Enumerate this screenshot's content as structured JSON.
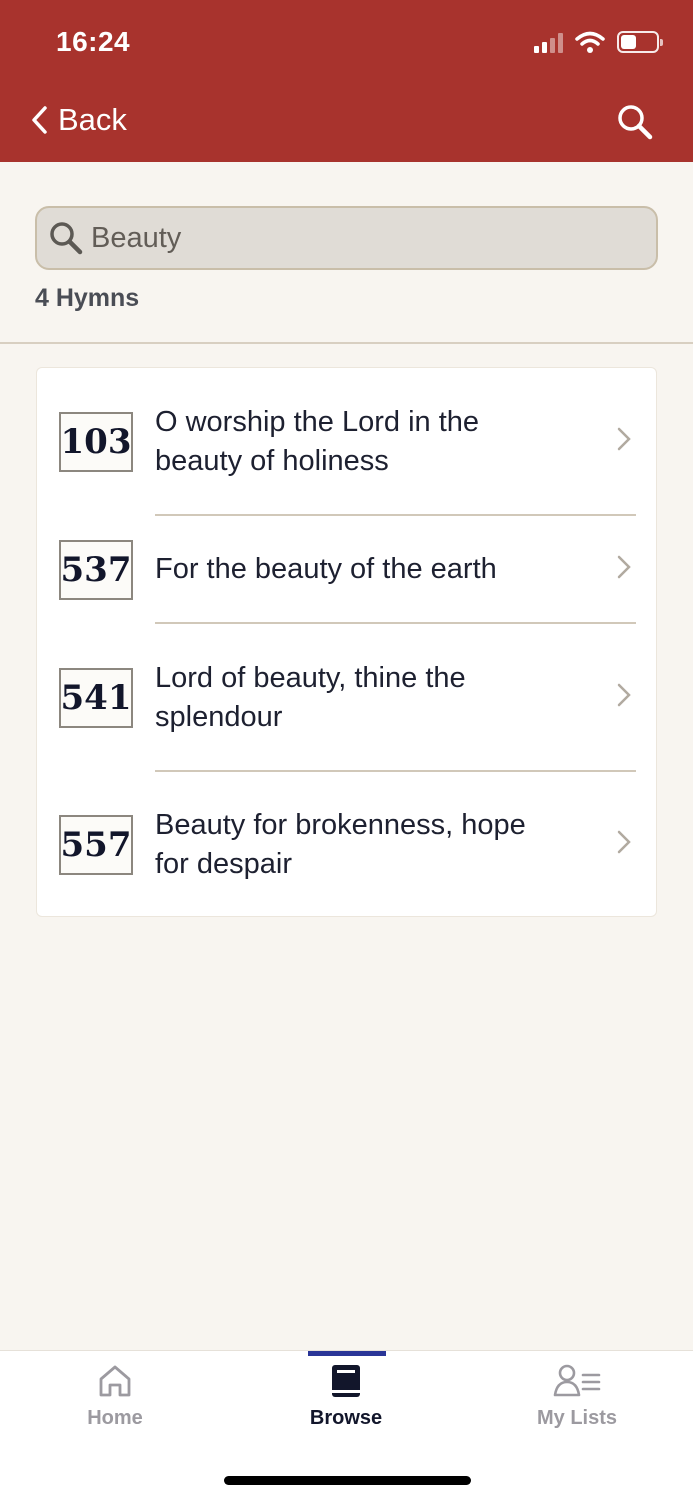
{
  "status_bar": {
    "time": "16:24"
  },
  "header": {
    "back_label": "Back"
  },
  "search": {
    "value": "Beauty"
  },
  "results": {
    "count_label": "4 Hymns"
  },
  "hymns": [
    {
      "number": "103",
      "title_line1": "O worship the Lord in the",
      "title_line2": "beauty of holiness"
    },
    {
      "number": "537",
      "title_line1": "For the beauty of the earth",
      "title_line2": ""
    },
    {
      "number": "541",
      "title_line1": "Lord of beauty, thine the",
      "title_line2": "splendour"
    },
    {
      "number": "557",
      "title_line1": "Beauty for brokenness, hope",
      "title_line2": "for despair"
    }
  ],
  "tabs": [
    {
      "label": "Home",
      "icon": "home-icon",
      "active": false
    },
    {
      "label": "Browse",
      "icon": "book-icon",
      "active": true
    },
    {
      "label": "My Lists",
      "icon": "person-list-icon",
      "active": false
    }
  ],
  "colors": {
    "header": "#a8332d",
    "tab_accent": "#2a3597",
    "background": "#f8f5f0"
  }
}
